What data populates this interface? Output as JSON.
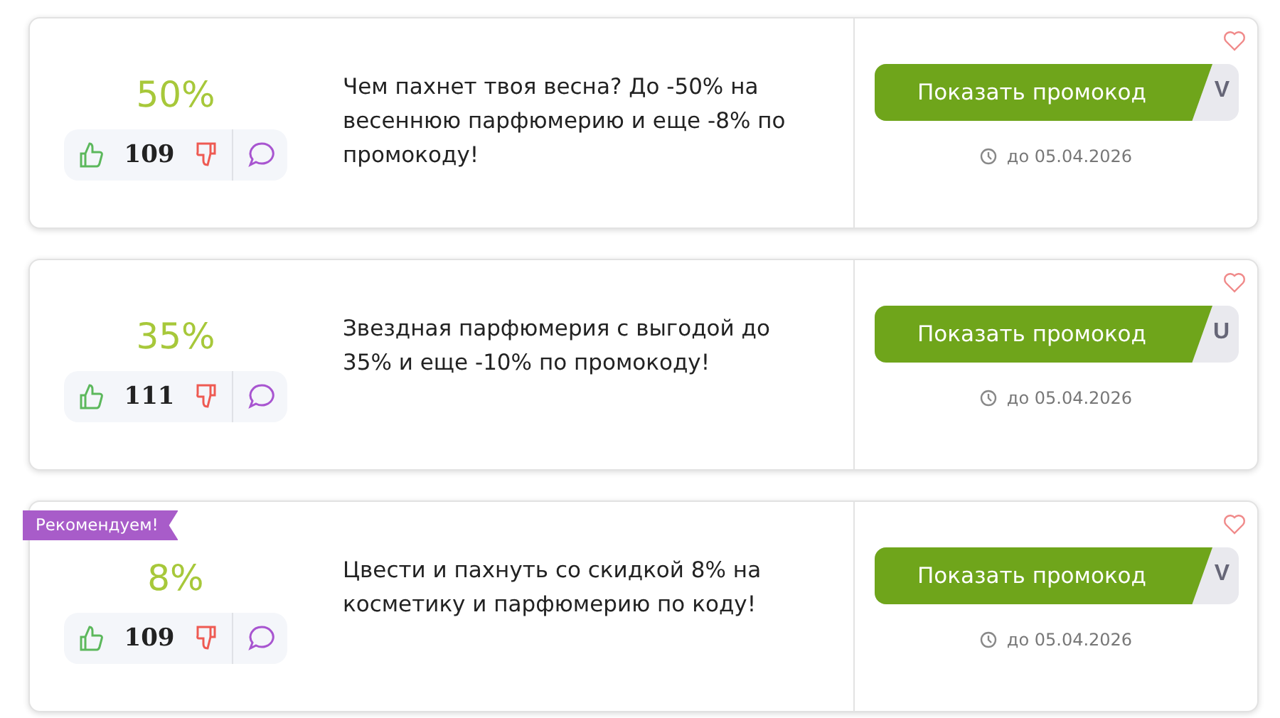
{
  "offers": [
    {
      "discount": "50%",
      "votes": "109",
      "description": "Чем пахнет твоя весна? До -50% на весеннюю парфюмерию и еще -8% по промокоду!",
      "button": "Показать промокод",
      "code_peek": "V",
      "expires": "до 05.04.2026"
    },
    {
      "discount": "35%",
      "votes": "111",
      "description": "Звездная парфюмерия с выгодой до 35% и еще -10% по промокоду!",
      "button": "Показать промокод",
      "code_peek": "U",
      "expires": "до 05.04.2026"
    },
    {
      "badge": "Рекомендуем!",
      "discount": "8%",
      "votes": "109",
      "description": "Цвести и пахнуть со скидкой 8% на косметику и парфюмерию по коду!",
      "button": "Показать промокод",
      "code_peek": "V",
      "expires": "до 05.04.2026"
    }
  ]
}
